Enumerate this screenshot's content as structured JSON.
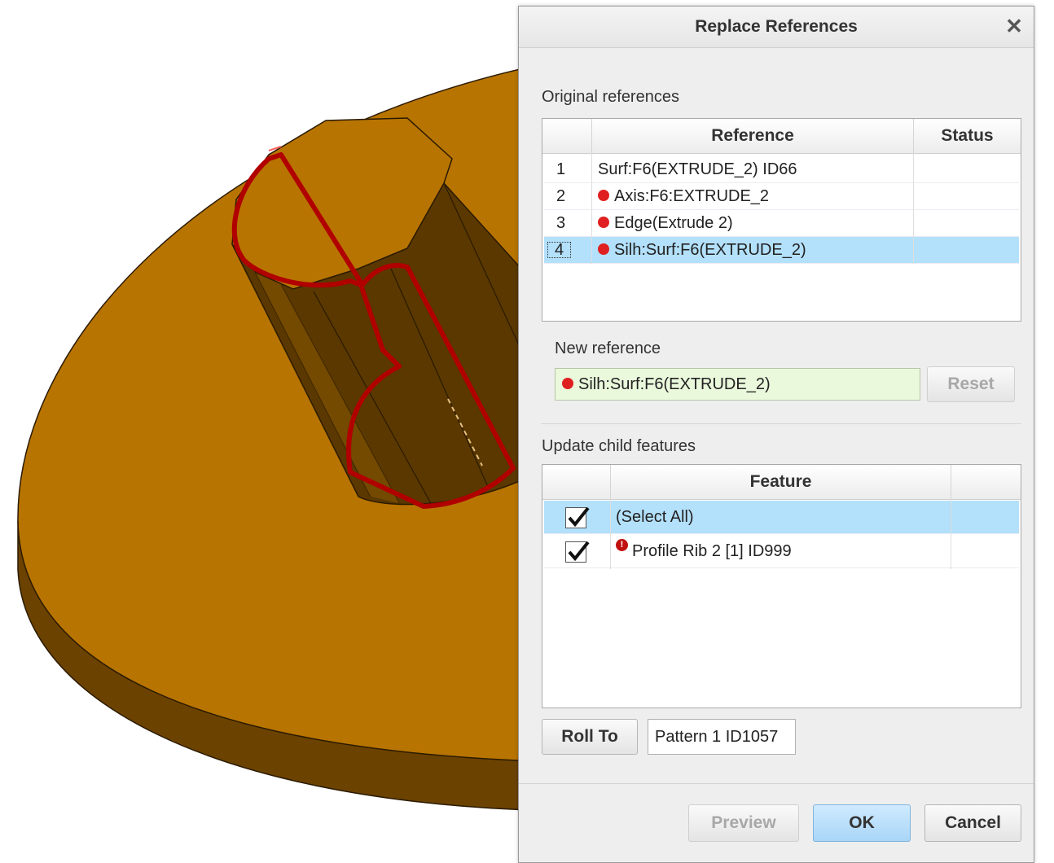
{
  "dialog": {
    "title": "Replace References",
    "close_symbol": "✕"
  },
  "original_references": {
    "label": "Original references",
    "columns": [
      "Reference",
      "Status"
    ],
    "rows": [
      {
        "num": "1",
        "reference": "Surf:F6(EXTRUDE_2) ID66",
        "status": "",
        "marker": false
      },
      {
        "num": "2",
        "reference": "Axis:F6:EXTRUDE_2",
        "status": "",
        "marker": true
      },
      {
        "num": "3",
        "reference": "Edge(Extrude 2)",
        "status": "",
        "marker": true
      },
      {
        "num": "4",
        "reference": "Silh:Surf:F6(EXTRUDE_2)",
        "status": "",
        "marker": true
      }
    ]
  },
  "new_reference": {
    "label": "New reference",
    "value": "Silh:Surf:F6(EXTRUDE_2)",
    "reset_label": "Reset"
  },
  "update_child_features": {
    "label": "Update child features",
    "columns": [
      "Feature"
    ],
    "rows": [
      {
        "checked": true,
        "feature": "(Select All)",
        "warning": false
      },
      {
        "checked": true,
        "feature": "Profile Rib 2 [1] ID999",
        "warning": true
      }
    ]
  },
  "roll_to": {
    "button_label": "Roll To",
    "value": "Pattern 1 ID1057"
  },
  "footer": {
    "preview_label": "Preview",
    "ok_label": "OK",
    "cancel_label": "Cancel"
  },
  "colors": {
    "model_top": "#b87400",
    "model_side": "#6b4200",
    "highlight": "#b00000",
    "selection": "#b3e0fb",
    "marker": "#e02020"
  }
}
